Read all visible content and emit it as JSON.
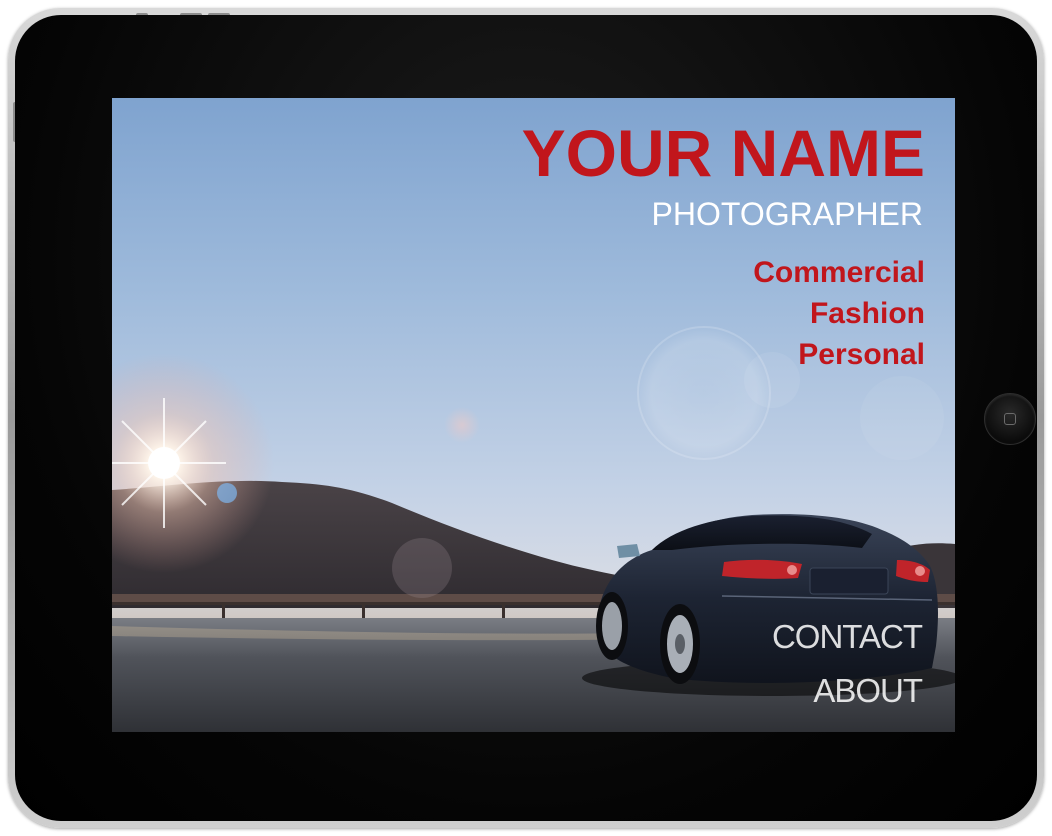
{
  "header": {
    "name": "YOUR NAME",
    "role": "PHOTOGRAPHER"
  },
  "menu": {
    "items": [
      {
        "label": "Commercial"
      },
      {
        "label": "Fashion"
      },
      {
        "label": "Personal"
      }
    ]
  },
  "nav": {
    "contact_label": "CONTACT",
    "about_label": "ABOUT"
  },
  "device": {
    "home_button_icon": "home-square-icon"
  },
  "colors": {
    "accent": "#c1161c",
    "secondary_text": "#ffffff",
    "bezel": "#050505"
  }
}
